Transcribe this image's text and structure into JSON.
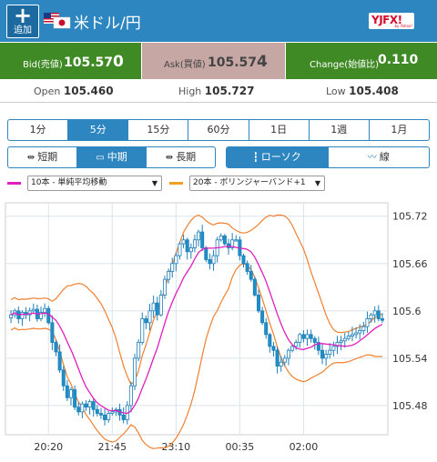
{
  "header": {
    "add_label": "追加",
    "pair_title": "米ドル/円",
    "logo_text": "YJFX!",
    "logo_sub": "by Yahoo!"
  },
  "quotes": {
    "bid_label": "Bid(売値)",
    "bid_main": "105.57",
    "bid_pip": "0",
    "ask_label": "Ask(買値)",
    "ask_main": "105.57",
    "ask_pip": "4",
    "change_label": "Change(始値比)",
    "change_value": "0.110"
  },
  "ohl": {
    "open_label": "Open",
    "open_value": "105.460",
    "high_label": "High",
    "high_value": "105.727",
    "low_label": "Low",
    "low_value": "105.408"
  },
  "timeframes": {
    "items": [
      "1分",
      "5分",
      "15分",
      "60分",
      "1日",
      "1週",
      "1月"
    ],
    "active_index": 1
  },
  "term_buttons": {
    "short": "短期",
    "mid": "中期",
    "long": "長期",
    "active": "mid"
  },
  "chart_type_buttons": {
    "candle": "ローソク",
    "line": "線",
    "active": "candle"
  },
  "indicators": {
    "ma_label": "10本 - 単純平均移動",
    "ma_color": "#e01fbf",
    "bb_label": "20本 - ボリンジャーバンド+1",
    "bb_color": "#f0a020"
  },
  "chart_data": {
    "type": "candlestick",
    "title": "",
    "y_ticks": [
      "105.72",
      "105.66",
      "105.6",
      "105.54",
      "105.48"
    ],
    "y_tick_values": [
      105.72,
      105.66,
      105.6,
      105.54,
      105.48
    ],
    "x_ticks": [
      "20:20",
      "21:45",
      "23:10",
      "00:35",
      "02:00"
    ],
    "ylim": [
      105.443,
      105.737
    ],
    "grid": true,
    "candle_up_color": "#2e86c1",
    "candle_down_color": "#1f8fc8",
    "ma_color": "#e01fbf",
    "bb_color": "#f08030",
    "closes": [
      105.595,
      105.6,
      105.59,
      105.598,
      105.595,
      105.6,
      105.602,
      105.59,
      105.598,
      105.603,
      105.585,
      105.56,
      105.548,
      105.525,
      105.505,
      105.49,
      105.5,
      105.478,
      105.472,
      105.482,
      105.478,
      105.485,
      105.475,
      105.47,
      105.468,
      105.462,
      105.47,
      105.472,
      105.475,
      105.468,
      105.462,
      105.48,
      105.505,
      105.54,
      105.56,
      105.59,
      105.585,
      105.6,
      105.61,
      105.595,
      105.62,
      105.64,
      105.65,
      105.66,
      105.67,
      105.685,
      105.69,
      105.675,
      105.68,
      105.69,
      105.7,
      105.68,
      105.665,
      105.66,
      105.67,
      105.69,
      105.695,
      105.685,
      105.68,
      105.69,
      105.69,
      105.67,
      105.66,
      105.65,
      105.64,
      105.62,
      105.6,
      105.585,
      105.57,
      105.555,
      105.55,
      105.53,
      105.535,
      105.54,
      105.55,
      105.555,
      105.56,
      105.57,
      105.565,
      105.57,
      105.565,
      105.56,
      105.55,
      105.54,
      105.545,
      105.55,
      105.555,
      105.56,
      105.562,
      105.565,
      105.568,
      105.57,
      105.572,
      105.575,
      105.58,
      105.59,
      105.595,
      105.6,
      105.59,
      105.588
    ]
  }
}
